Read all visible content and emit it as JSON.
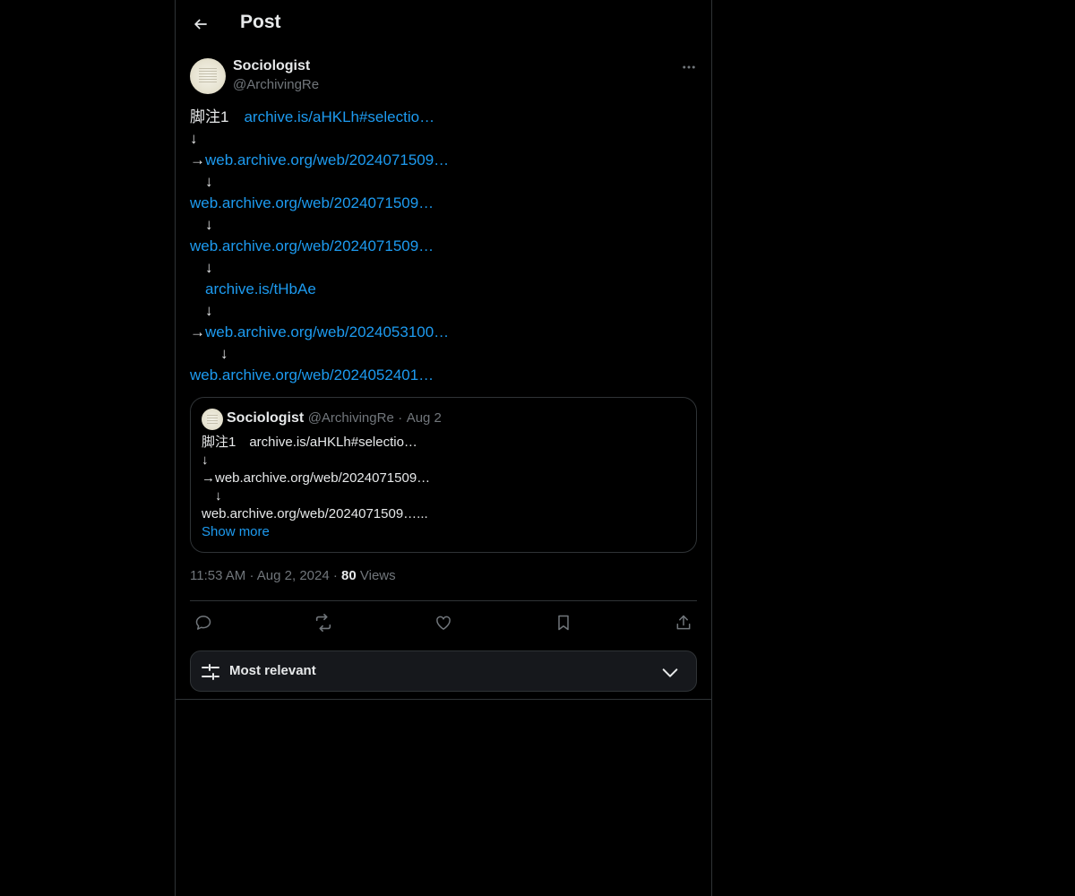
{
  "header": {
    "title": "Post"
  },
  "author": {
    "name": "Sociologist",
    "handle": "@ArchivingRe"
  },
  "post": {
    "lines": [
      {
        "text": "脚注1　",
        "link": "archive.is/aHKLh#selectio…"
      },
      {
        "text": "↓",
        "link": ""
      },
      {
        "text": "→",
        "link": "web.archive.org/web/2024071509…"
      },
      {
        "text": "　↓",
        "link": ""
      },
      {
        "text": "",
        "link": "web.archive.org/web/2024071509…"
      },
      {
        "text": "　↓",
        "link": ""
      },
      {
        "text": "",
        "link": "web.archive.org/web/2024071509…"
      },
      {
        "text": "　↓",
        "link": ""
      },
      {
        "text": "　",
        "link": "archive.is/tHbAe"
      },
      {
        "text": "　↓",
        "link": ""
      },
      {
        "text": "→",
        "link": "web.archive.org/web/2024053100…"
      },
      {
        "text": "　　↓",
        "link": ""
      },
      {
        "text": "",
        "link": "web.archive.org/web/2024052401…"
      }
    ]
  },
  "quote": {
    "name": "Sociologist",
    "handle": "@ArchivingRe",
    "separator": "·",
    "date": "Aug 2",
    "lines": [
      "脚注1　archive.is/aHKLh#selectio…",
      "↓",
      "→web.archive.org/web/2024071509…",
      "　↓",
      "web.archive.org/web/2024071509…..."
    ],
    "show_more": "Show more"
  },
  "meta": {
    "time": "11:53 AM",
    "separator": "·",
    "date": "Aug 2, 2024",
    "views_count": "80",
    "views_label": " Views"
  },
  "actions": {
    "icons": [
      "reply-icon",
      "repost-icon",
      "like-icon",
      "bookmark-icon",
      "share-icon"
    ]
  },
  "sort": {
    "label": "Most relevant"
  },
  "colors": {
    "background": "#000000",
    "text": "#e7e9ea",
    "muted": "#71767b",
    "link": "#1d9bf0",
    "border": "#2f3336",
    "sort_bg": "#16181c"
  }
}
